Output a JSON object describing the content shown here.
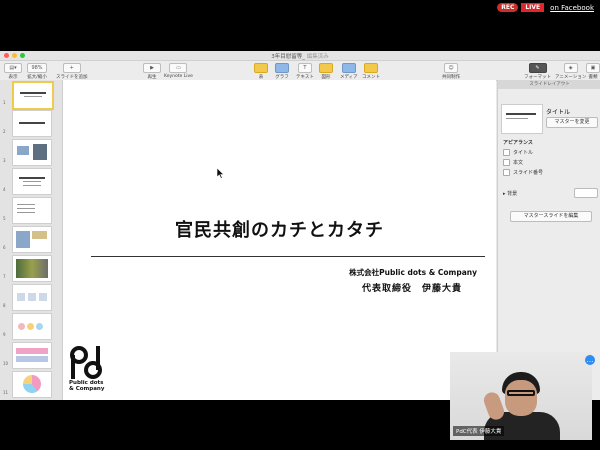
{
  "live": {
    "rec": "REC",
    "live": "LIVE",
    "link": "on Facebook"
  },
  "window": {
    "title": "3年目慰留等_ 編集済み",
    "title_main": "3年目慰留等_",
    "title_edited": "編集済み"
  },
  "toolbar": {
    "view": {
      "icon": "view-icon",
      "label": "表示"
    },
    "zoom": {
      "value": "98%",
      "label": "拡大/縮小"
    },
    "add_slide": {
      "icon": "plus-icon",
      "label": "スライドを追加"
    },
    "play": {
      "icon": "play-icon",
      "label": "再生"
    },
    "keynote_live": {
      "icon": "keynote-live-icon",
      "label": "Keynote Live"
    },
    "table": {
      "icon": "table-icon",
      "label": "表"
    },
    "chart": {
      "icon": "chart-icon",
      "label": "グラフ"
    },
    "text": {
      "icon": "text-icon",
      "label": "テキスト"
    },
    "shape": {
      "icon": "shape-icon",
      "label": "図形"
    },
    "media": {
      "icon": "media-icon",
      "label": "メディア"
    },
    "comment": {
      "icon": "comment-icon",
      "label": "コメント"
    },
    "collaborate": {
      "icon": "collaborate-icon",
      "label": "共同制作"
    },
    "format": {
      "icon": "format-icon",
      "label": "フォーマット"
    },
    "animate": {
      "icon": "animate-icon",
      "label": "アニメーション"
    },
    "document": {
      "icon": "document-icon",
      "label": "書類"
    }
  },
  "navigator": {
    "slides": [
      "1",
      "2",
      "3",
      "4",
      "5",
      "6",
      "7",
      "8",
      "9",
      "10",
      "11"
    ]
  },
  "slide": {
    "title": "官民共創のカチとカタチ",
    "company": "株式会社Public dots & Company",
    "presenter": "代表取締役　伊藤大貴",
    "logo_mark": "pdc",
    "logo_text_1": "Public dots",
    "logo_text_2": "& Company"
  },
  "inspector": {
    "header": "スライドレイアウト",
    "layout_name": "タイトル",
    "change_master": "マスターを変更",
    "appearance": "アピアランス",
    "checkbox_title": "タイトル",
    "checkbox_body": "本文",
    "checkbox_number": "スライド番号",
    "background": "背景",
    "edit_master": "マスタースライドを編集"
  },
  "video": {
    "name": "PdC代表 伊藤大貴"
  }
}
